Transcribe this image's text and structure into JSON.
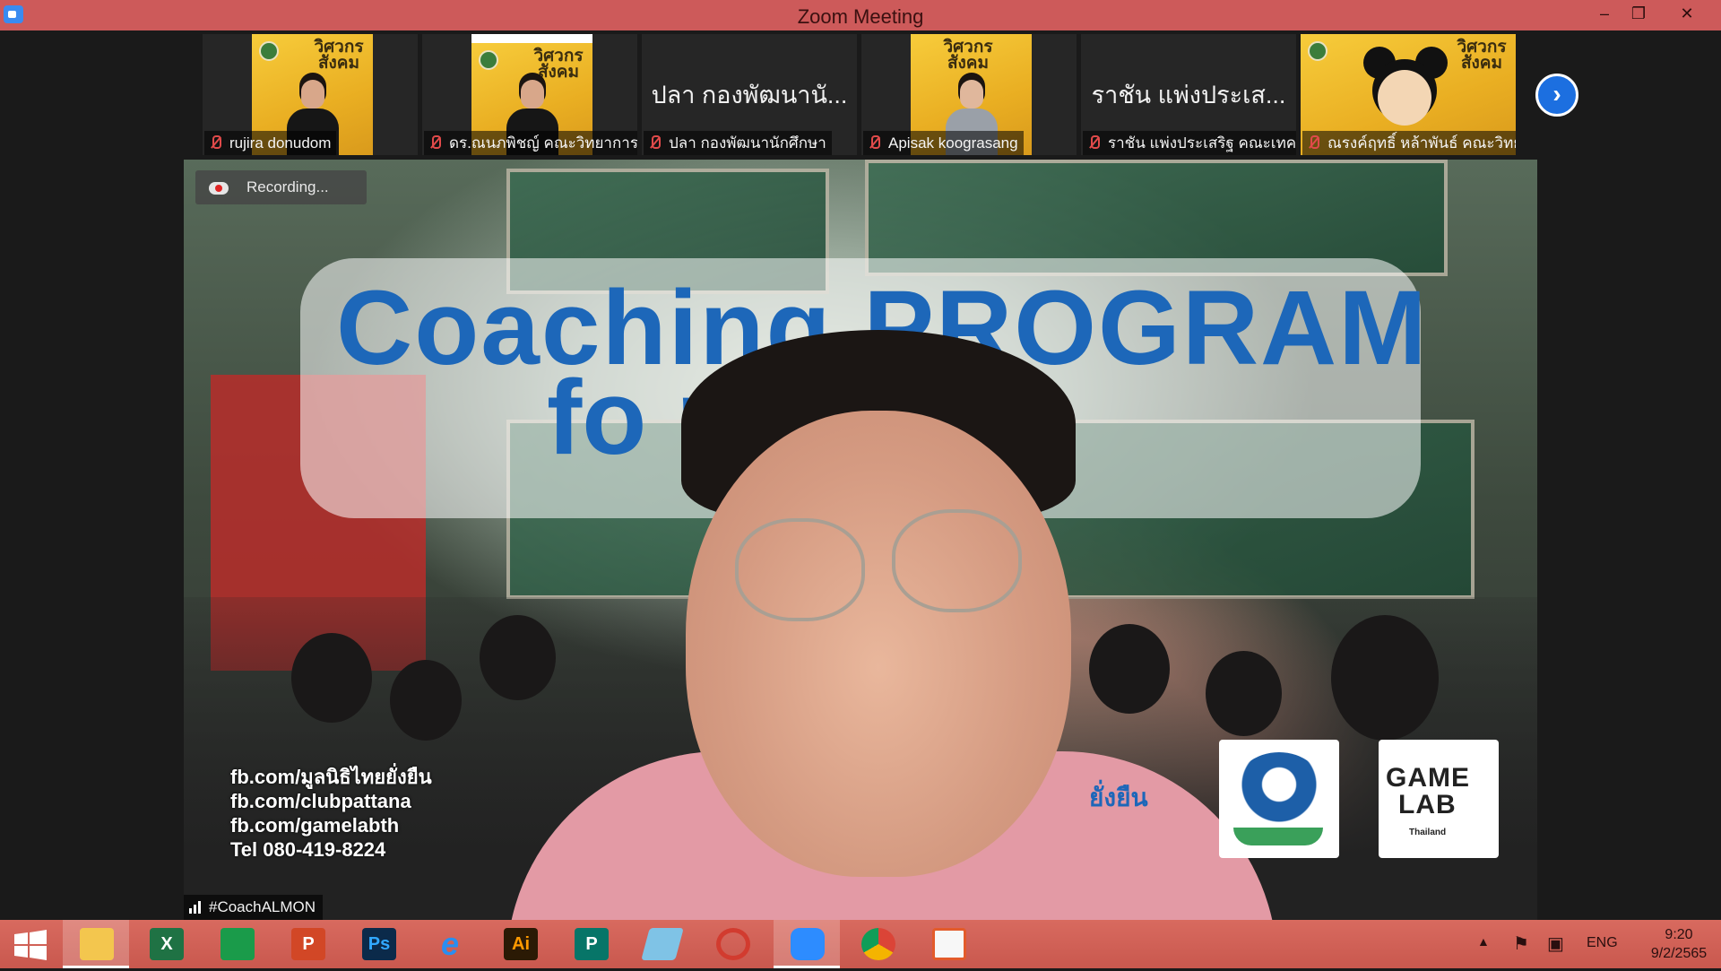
{
  "window": {
    "title": "Zoom Meeting",
    "controls": {
      "minimize": "–",
      "restore": "❐",
      "close": "✕"
    }
  },
  "participants": [
    {
      "name": "rujira donudom",
      "tile": "poster"
    },
    {
      "name": "ดร.ณนภพิชญ์ คณะวิทยาการ...",
      "tile": "poster"
    },
    {
      "name": "ปลา กองพัฒนานักศึกษา",
      "display_name": "ปลา กองพัฒนานั...",
      "tile": "name"
    },
    {
      "name": "Apisak koograsang",
      "tile": "poster"
    },
    {
      "name": "ราชัน แพ่งประเสริฐ คณะเทค...",
      "display_name": "ราชัน แพ่งประเส...",
      "tile": "name"
    },
    {
      "name": "ณรงค์ฤทธิ์ หล้าพันธ์ คณะวิทย์",
      "tile": "mickey"
    }
  ],
  "poster_text": "วิศวกรสังคม",
  "next_page_icon": "chevron-right-icon",
  "recording": {
    "label": "Recording..."
  },
  "active_speaker": {
    "name": "#CoachALMON",
    "background": {
      "headline_1": "Coaching PROGRAM",
      "headline_2": "fo       rer",
      "contacts": [
        "fb.com/มูลนิธิไทยยั่งยืน",
        "fb.com/clubpattana",
        "fb.com/gamelabth",
        "Tel 080-419-8224"
      ],
      "partner_text": "ยั่งยืน",
      "logo_gamelab_1": "GAME",
      "logo_gamelab_2": "LAB",
      "logo_gamelab_sub": "Thailand"
    }
  },
  "taskbar": {
    "apps": [
      {
        "name": "start",
        "label": ""
      },
      {
        "name": "file-explorer",
        "label": ""
      },
      {
        "name": "excel",
        "label": "X"
      },
      {
        "name": "store",
        "label": ""
      },
      {
        "name": "powerpoint",
        "label": "P"
      },
      {
        "name": "photoshop",
        "label": "Ps"
      },
      {
        "name": "internet-explorer",
        "label": "e"
      },
      {
        "name": "illustrator",
        "label": "Ai"
      },
      {
        "name": "publisher",
        "label": "P"
      },
      {
        "name": "app-blue",
        "label": ""
      },
      {
        "name": "photoscape",
        "label": ""
      },
      {
        "name": "zoom",
        "label": ""
      },
      {
        "name": "chrome",
        "label": ""
      },
      {
        "name": "office-app",
        "label": ""
      }
    ],
    "tray": {
      "language": "ENG",
      "time": "9:20",
      "date": "9/2/2565"
    }
  },
  "colors": {
    "titlebar": "#cd5a5a",
    "taskbar": "#c9584e",
    "accent": "#1c6fe0",
    "recording": "#e02424"
  }
}
